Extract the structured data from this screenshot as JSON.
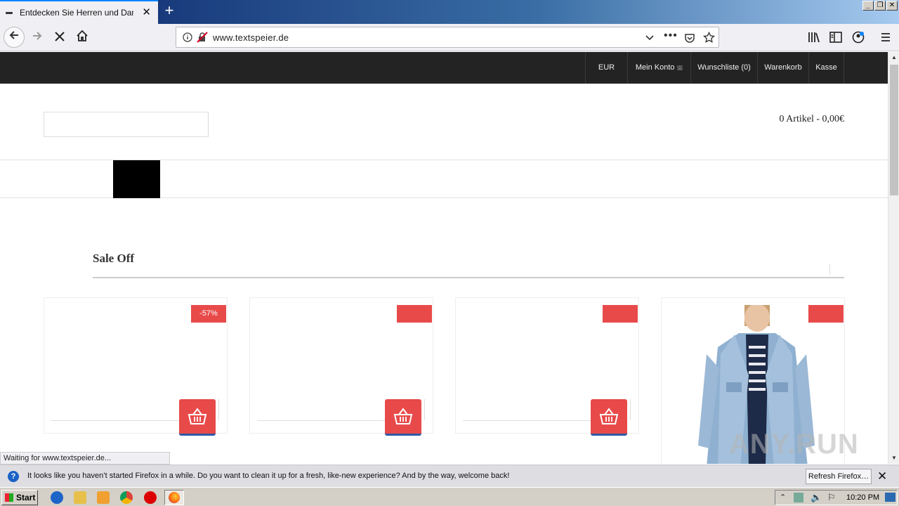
{
  "browser": {
    "tab_title": "Entdecken Sie Herren und Damen",
    "url": "www.textspeier.de",
    "window_buttons": [
      "_",
      "❐",
      "✕"
    ]
  },
  "site": {
    "topbar": {
      "currency": "EUR",
      "account": "Mein Konto",
      "wishlist": "Wunschliste (0)",
      "basket": "Warenkorb",
      "checkout": "Kasse"
    },
    "cart_summary": "0 Artikel - 0,00€",
    "section_title": "Sale Off",
    "products": [
      {
        "badge": "-57%"
      },
      {
        "badge": ""
      },
      {
        "badge": ""
      },
      {
        "badge": ""
      }
    ]
  },
  "status_text": "Waiting for www.textspeier.de...",
  "watermark": "ANY.RUN",
  "notification": {
    "text": "It looks like you haven’t started Firefox in a while. Do you want to clean it up for a fresh, like-new experience? And by the way, welcome back!",
    "button": "Refresh Firefox…"
  },
  "taskbar": {
    "start_label": "Start",
    "clock": "10:20 PM"
  },
  "colors": {
    "accent_red": "#e84a4a",
    "topbar_bg": "#232323"
  }
}
